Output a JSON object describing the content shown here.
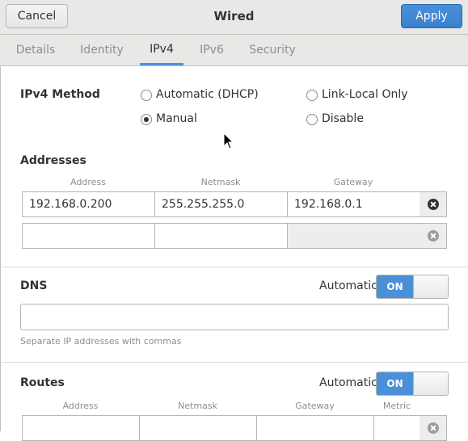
{
  "header": {
    "cancel_label": "Cancel",
    "title": "Wired",
    "apply_label": "Apply"
  },
  "tabs": [
    {
      "label": "Details"
    },
    {
      "label": "Identity"
    },
    {
      "label": "IPv4"
    },
    {
      "label": "IPv6"
    },
    {
      "label": "Security"
    }
  ],
  "active_tab": "IPv4",
  "ipv4_method": {
    "label": "IPv4 Method",
    "options": [
      {
        "label": "Automatic (DHCP)",
        "checked": false
      },
      {
        "label": "Link-Local Only",
        "checked": false
      },
      {
        "label": "Manual",
        "checked": true
      },
      {
        "label": "Disable",
        "checked": false
      }
    ]
  },
  "addresses": {
    "title": "Addresses",
    "columns": [
      "Address",
      "Netmask",
      "Gateway"
    ],
    "rows": [
      {
        "address": "192.168.0.200",
        "netmask": "255.255.255.0",
        "gateway": "192.168.0.1"
      },
      {
        "address": "",
        "netmask": "",
        "gateway": ""
      }
    ]
  },
  "dns": {
    "title": "DNS",
    "automatic_label": "Automatic",
    "switch_label": "ON",
    "switch_on": true,
    "value": "",
    "hint": "Separate IP addresses with commas"
  },
  "routes": {
    "title": "Routes",
    "automatic_label": "Automatic",
    "switch_label": "ON",
    "switch_on": true,
    "columns": [
      "Address",
      "Netmask",
      "Gateway",
      "Metric"
    ]
  },
  "colors": {
    "accent": "#4a90d9",
    "header_bg": "#e8e8e7"
  }
}
